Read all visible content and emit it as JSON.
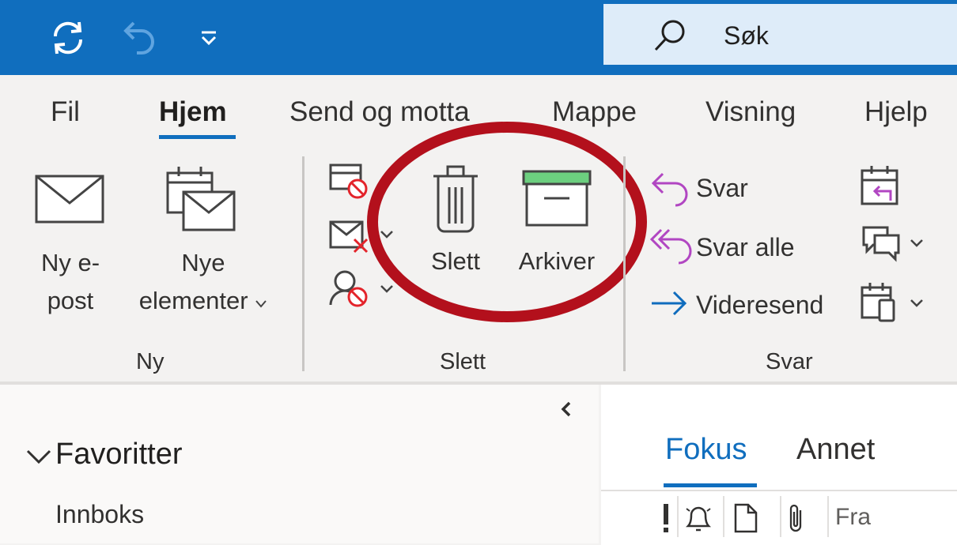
{
  "titlebar": {
    "search_label": "Søk",
    "icons": [
      "sync-icon",
      "undo-icon",
      "customize-qat-icon",
      "search-icon"
    ]
  },
  "tabs": [
    {
      "label": "Fil",
      "active": false
    },
    {
      "label": "Hjem",
      "active": true
    },
    {
      "label": "Send og motta",
      "active": false
    },
    {
      "label": "Mappe",
      "active": false
    },
    {
      "label": "Visning",
      "active": false
    },
    {
      "label": "Hjelp",
      "active": false
    }
  ],
  "ribbon": {
    "ny": {
      "group_label": "Ny",
      "new_email_line1": "Ny e-",
      "new_email_line2": "post",
      "new_items_line1": "Nye",
      "new_items_line2": "elementer"
    },
    "slett": {
      "group_label": "Slett",
      "delete_label": "Slett",
      "archive_label": "Arkiver"
    },
    "svar": {
      "group_label": "Svar",
      "reply_label": "Svar",
      "reply_all_label": "Svar alle",
      "forward_label": "Videresend"
    }
  },
  "colors": {
    "titlebar": "#106ebe",
    "accent": "#106ebe",
    "reply_purple": "#b146c2",
    "forward_blue": "#0f6cbd",
    "annotation_circle": "#b3101c",
    "archive_green": "#6ccf7f",
    "delete_red": "#e3242b"
  },
  "folder_pane": {
    "favorites_label": "Favoritter",
    "inbox_label": "Innboks"
  },
  "message_list": {
    "tab_focused": "Fokus",
    "tab_other": "Annet",
    "column_from": "Fra"
  }
}
